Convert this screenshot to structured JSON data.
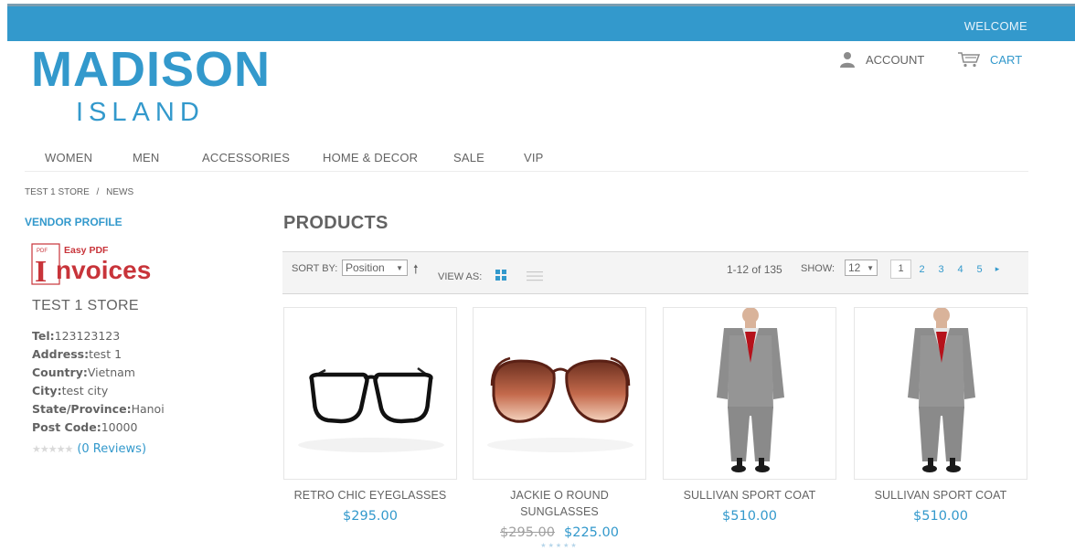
{
  "header": {
    "welcome": "WELCOME",
    "logo_line1": "MADISON",
    "logo_line2": "ISLAND",
    "account_label": "ACCOUNT",
    "cart_label": "CART",
    "account_icon": "user-icon",
    "cart_icon": "cart-icon"
  },
  "nav": {
    "items": [
      "WOMEN",
      "MEN",
      "ACCESSORIES",
      "HOME & DECOR",
      "SALE",
      "VIP"
    ]
  },
  "breadcrumb": {
    "store": "TEST 1 STORE",
    "separator": "/",
    "current": "NEWS"
  },
  "vendor": {
    "section_title": "VENDOR PROFILE",
    "logo_small_text": "Easy PDF",
    "logo_pdf_tag": "PDF",
    "logo_initial": "I",
    "logo_rest": "nvoices",
    "store_name": "TEST 1 STORE",
    "fields": [
      {
        "label": "Tel:",
        "value": "123123123"
      },
      {
        "label": "Address:",
        "value": "test 1"
      },
      {
        "label": "Country:",
        "value": "Vietnam"
      },
      {
        "label": "City:",
        "value": "test city"
      },
      {
        "label": "State/Province:",
        "value": "Hanoi"
      },
      {
        "label": "Post Code:",
        "value": "10000"
      }
    ],
    "rating_stars": "★★★★★",
    "rating": 0,
    "reviews_text": "(0 Reviews)"
  },
  "products_section": {
    "title": "PRODUCTS",
    "sort_label": "SORT BY:",
    "sort_value": "Position",
    "sort_direction_icon": "arrow-up-icon",
    "view_label": "VIEW AS:",
    "view_mode": "grid",
    "count_text": "1-12 of 135",
    "show_label": "SHOW:",
    "show_value": "12",
    "pages": [
      "1",
      "2",
      "3",
      "4",
      "5"
    ],
    "current_page": "1",
    "next_symbol": "▸"
  },
  "products": [
    {
      "name": "RETRO CHIC EYEGLASSES",
      "price": "$295.00",
      "old_price": "",
      "image": "eyeglasses"
    },
    {
      "name": "JACKIE O ROUND SUNGLASSES",
      "price": "$225.00",
      "old_price": "$295.00",
      "image": "sunglasses"
    },
    {
      "name": "SULLIVAN SPORT COAT",
      "price": "$510.00",
      "old_price": "",
      "image": "suit"
    },
    {
      "name": "SULLIVAN SPORT COAT",
      "price": "$510.00",
      "old_price": "",
      "image": "suit"
    }
  ],
  "colors": {
    "brand": "#3399cc",
    "text": "#636363",
    "toolbar_bg": "#f4f4f4"
  }
}
